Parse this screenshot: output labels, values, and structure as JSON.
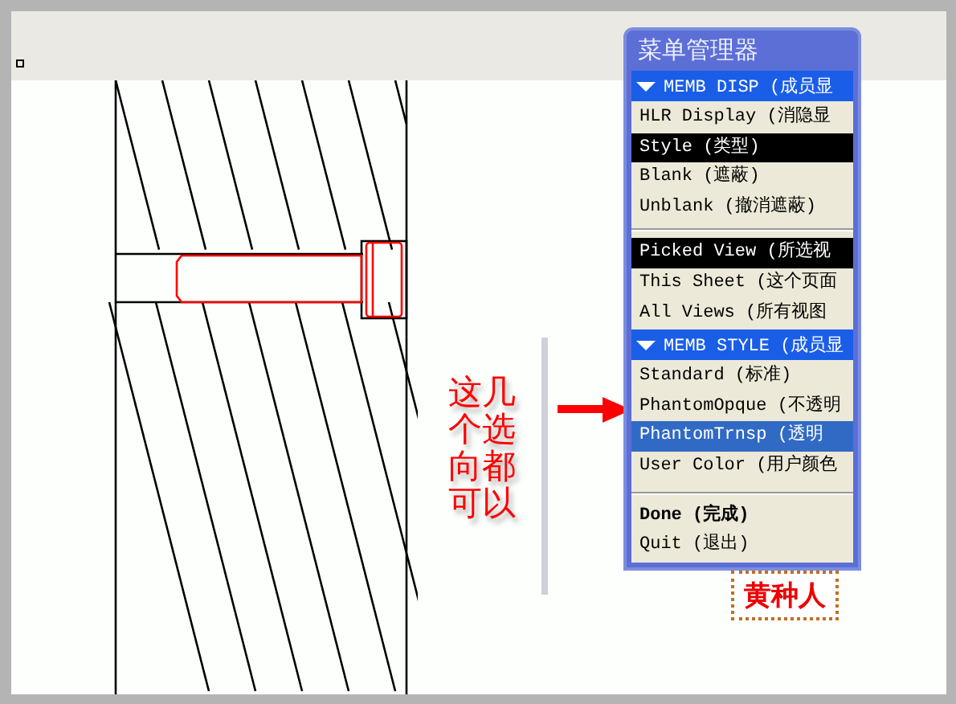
{
  "menu_manager": {
    "title": "菜单管理器",
    "sections": [
      {
        "header": "MEMB DISP (成员显",
        "expanded": true,
        "groups": [
          [
            {
              "label": "HLR Display (消隐显",
              "selected": false,
              "highlighted": false
            },
            {
              "label": "Style (类型)",
              "selected": true,
              "highlighted": false
            },
            {
              "label": "Blank (遮蔽)",
              "selected": false,
              "highlighted": false
            },
            {
              "label": "Unblank (撤消遮蔽)",
              "selected": false,
              "highlighted": false
            }
          ],
          [
            {
              "label": "Picked View (所选视",
              "selected": true,
              "highlighted": false
            },
            {
              "label": "This Sheet (这个页面",
              "selected": false,
              "highlighted": false
            },
            {
              "label": "All Views (所有视图",
              "selected": false,
              "highlighted": false
            }
          ]
        ]
      },
      {
        "header": "MEMB STYLE (成员显",
        "expanded": true,
        "groups": [
          [
            {
              "label": "Standard (标准)",
              "selected": false,
              "highlighted": false
            },
            {
              "label": "PhantomOpque (不透明",
              "selected": false,
              "highlighted": false
            },
            {
              "label": "PhantomTrnsp (透明",
              "selected": false,
              "highlighted": true
            },
            {
              "label": "User Color (用户颜色",
              "selected": false,
              "highlighted": false
            }
          ]
        ]
      }
    ],
    "footer_items": [
      {
        "label": "Done (完成)",
        "kind": "emphasis"
      },
      {
        "label": "Quit (退出)",
        "kind": "plain"
      }
    ]
  },
  "callout": {
    "text": "这几个选向都可以"
  },
  "stamp": {
    "text": "黄种人"
  }
}
